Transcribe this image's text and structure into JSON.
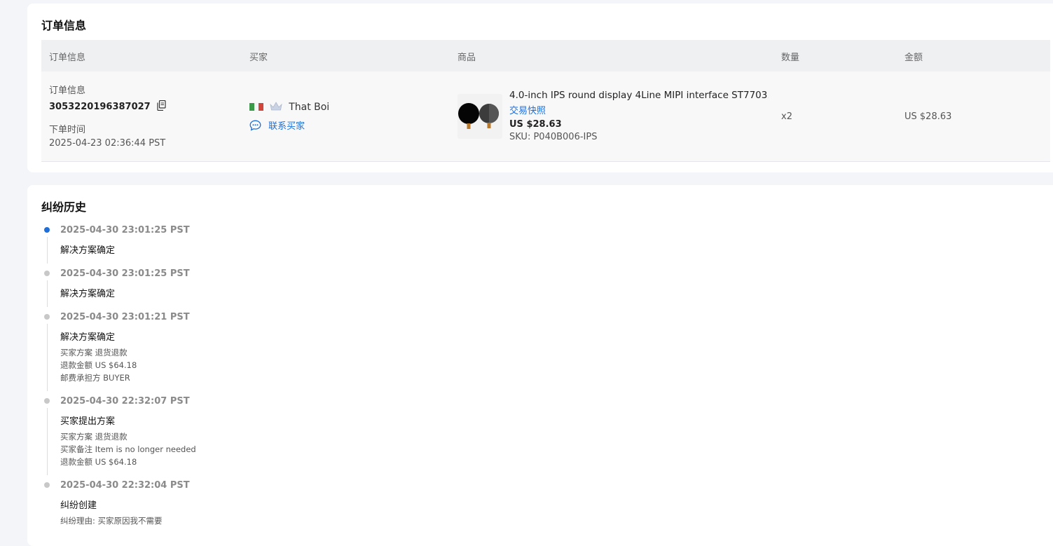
{
  "order_info": {
    "section_title": "订单信息",
    "columns": [
      "订单信息",
      "买家",
      "商品",
      "数量",
      "金额"
    ],
    "row": {
      "order_label": "订单信息",
      "order_number": "3053220196387027",
      "placed_label": "下单时间",
      "placed_time": "2025-04-23 02:36:44 PST",
      "buyer_name": "That Boi",
      "contact_label": "联系买家",
      "product_name": "4.0-inch IPS round display 4Line MIPI interface ST7703…",
      "snapshot_label": "交易快照",
      "unit_price": "US $28.63",
      "sku": "SKU: P040B006-IPS",
      "quantity": "x2",
      "amount": "US $28.63"
    },
    "icons": {
      "copy": "copy-icon",
      "flag": "italy-flag-icon",
      "crown": "crown-icon",
      "chat": "chat-bubble-icon"
    },
    "colors": {
      "link": "#1e6fd9",
      "flag_green": "#3a9a4a",
      "flag_white": "#f4f4f4",
      "flag_red": "#d2453a"
    }
  },
  "dispute_history": {
    "section_title": "纠纷历史",
    "events": [
      {
        "time": "2025-04-30 23:01:25 PST",
        "title": "解决方案确定",
        "details": [],
        "active": true
      },
      {
        "time": "2025-04-30 23:01:25 PST",
        "title": "解决方案确定",
        "details": [],
        "active": false
      },
      {
        "time": "2025-04-30 23:01:21 PST",
        "title": "解决方案确定",
        "details": [
          "买家方案 退货退款",
          "退款金额 US $64.18",
          "邮费承担方 BUYER"
        ],
        "active": false
      },
      {
        "time": "2025-04-30 22:32:07 PST",
        "title": "买家提出方案",
        "details": [
          "买家方案 退货退款",
          "买家备注 Item is no longer needed",
          "退款金额 US $64.18"
        ],
        "active": false
      },
      {
        "time": "2025-04-30 22:32:04 PST",
        "title": "纠纷创建",
        "details": [
          "纠纷理由: 买家原因我不需要"
        ],
        "active": false
      }
    ],
    "colors": {
      "active_dot": "#1e6fd9",
      "inactive_dot": "#c8c8c8"
    }
  }
}
